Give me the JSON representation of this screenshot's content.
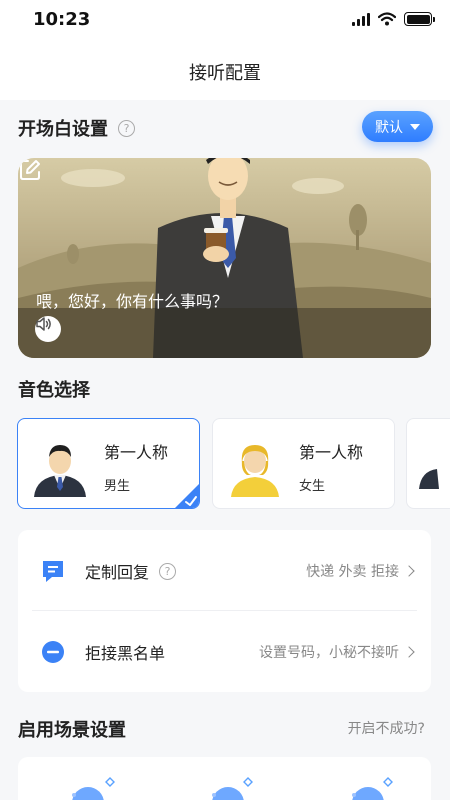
{
  "status_bar": {
    "time": "10:23"
  },
  "nav": {
    "title": "接听配置"
  },
  "greeting": {
    "title": "开场白设置",
    "default_label": "默认",
    "text": "喂，您好，你有什么事吗？"
  },
  "voice": {
    "title": "音色选择",
    "options": [
      {
        "name": "第一人称",
        "gender": "男生",
        "selected": true
      },
      {
        "name": "第一人称",
        "gender": "女生",
        "selected": false
      }
    ]
  },
  "menu": {
    "items": [
      {
        "label": "定制回复",
        "value": "快递 外卖 拒接"
      },
      {
        "label": "拒接黑名单",
        "value": "设置号码，小秘不接听"
      }
    ]
  },
  "scene": {
    "title": "启用场景设置",
    "fail_link": "开启不成功?"
  },
  "colors": {
    "accent": "#2f7dff",
    "background": "#f6f7f9",
    "card": "#ffffff"
  }
}
